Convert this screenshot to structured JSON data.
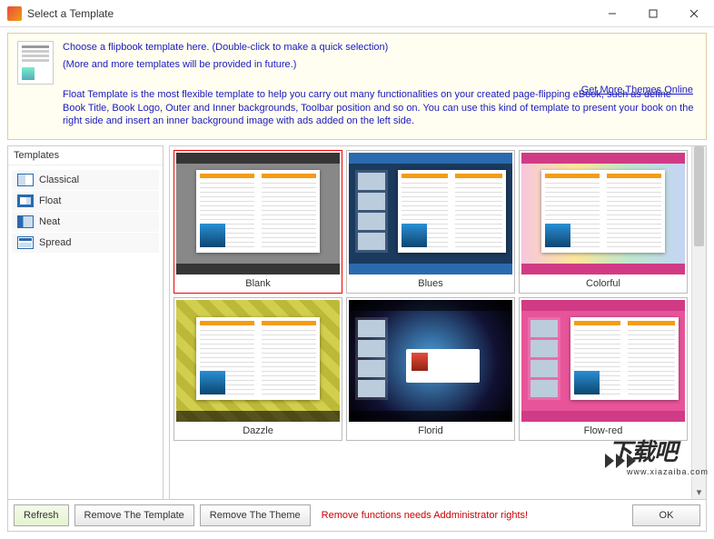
{
  "window": {
    "title": "Select a Template"
  },
  "info": {
    "line1": "Choose a flipbook template here. (Double-click to make a quick selection)",
    "line2": "(More and more templates will be provided in future.)",
    "desc": "Float Template is the most flexible template to help you carry out many functionalities on your created page-flipping eBook, such as define Book Title, Book Logo, Outer and Inner backgrounds, Toolbar position and so on. You can use this kind of template to present your book on the right side and insert an inner background image with ads added on the left side.",
    "more_link": "Get More Themes Online"
  },
  "sidebar": {
    "header": "Templates",
    "items": [
      {
        "label": "Classical",
        "icon": "classical"
      },
      {
        "label": "Float",
        "icon": "float"
      },
      {
        "label": "Neat",
        "icon": "neat"
      },
      {
        "label": "Spread",
        "icon": "spread"
      }
    ]
  },
  "gallery": {
    "items": [
      {
        "label": "Blank"
      },
      {
        "label": "Blues"
      },
      {
        "label": "Colorful"
      },
      {
        "label": "Dazzle"
      },
      {
        "label": "Florid"
      },
      {
        "label": "Flow-red"
      }
    ]
  },
  "bottom": {
    "refresh": "Refresh",
    "remove_template": "Remove The Template",
    "remove_theme": "Remove The Theme",
    "warning": "Remove functions needs Addministrator rights!",
    "ok": "OK"
  },
  "watermark": {
    "text": "下载吧",
    "sub": "www.xiazaiba.com"
  }
}
